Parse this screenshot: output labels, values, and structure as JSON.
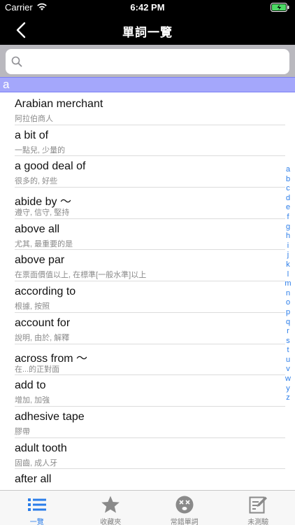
{
  "status": {
    "carrier": "Carrier",
    "time": "6:42 PM"
  },
  "nav": {
    "title": "單詞一覽"
  },
  "search": {
    "placeholder": ""
  },
  "section": {
    "letter": "a"
  },
  "rows": [
    {
      "word": "Arabian merchant",
      "meaning": "阿拉伯商人"
    },
    {
      "word": "a bit of",
      "meaning": "一點兒, 少量的"
    },
    {
      "word": "a good deal of",
      "meaning": "很多的, 好些"
    },
    {
      "word": "abide by ～",
      "meaning": "遵守, 信守, 堅持"
    },
    {
      "word": "above all",
      "meaning": "尤其, 最重要的是"
    },
    {
      "word": "above par",
      "meaning": "在票面價值以上, 在標準[一般水準]以上"
    },
    {
      "word": "according to",
      "meaning": "根據, 按照"
    },
    {
      "word": "account for",
      "meaning": "說明, 由於, 解釋"
    },
    {
      "word": "across from ～",
      "meaning": "在...的正對面"
    },
    {
      "word": "add to",
      "meaning": "增加, 加強"
    },
    {
      "word": "adhesive tape",
      "meaning": "膠帶"
    },
    {
      "word": "adult tooth",
      "meaning": "固齒, 成人牙"
    },
    {
      "word": "after all",
      "meaning": ""
    }
  ],
  "index": [
    "a",
    "b",
    "c",
    "d",
    "e",
    "f",
    "g",
    "h",
    "i",
    "j",
    "k",
    "l",
    "m",
    "n",
    "o",
    "p",
    "q",
    "r",
    "s",
    "t",
    "u",
    "v",
    "w",
    "y",
    "z"
  ],
  "tabs": [
    {
      "label": "一覽",
      "icon": "list-icon",
      "active": true
    },
    {
      "label": "收藏夾",
      "icon": "star-icon",
      "active": false
    },
    {
      "label": "常錯單詞",
      "icon": "dizzy-face-icon",
      "active": false
    },
    {
      "label": "未測驗",
      "icon": "edit-note-icon",
      "active": false
    }
  ],
  "colors": {
    "accent": "#2b7de9",
    "section": "#a4a7fb",
    "navbar": "#000000"
  }
}
